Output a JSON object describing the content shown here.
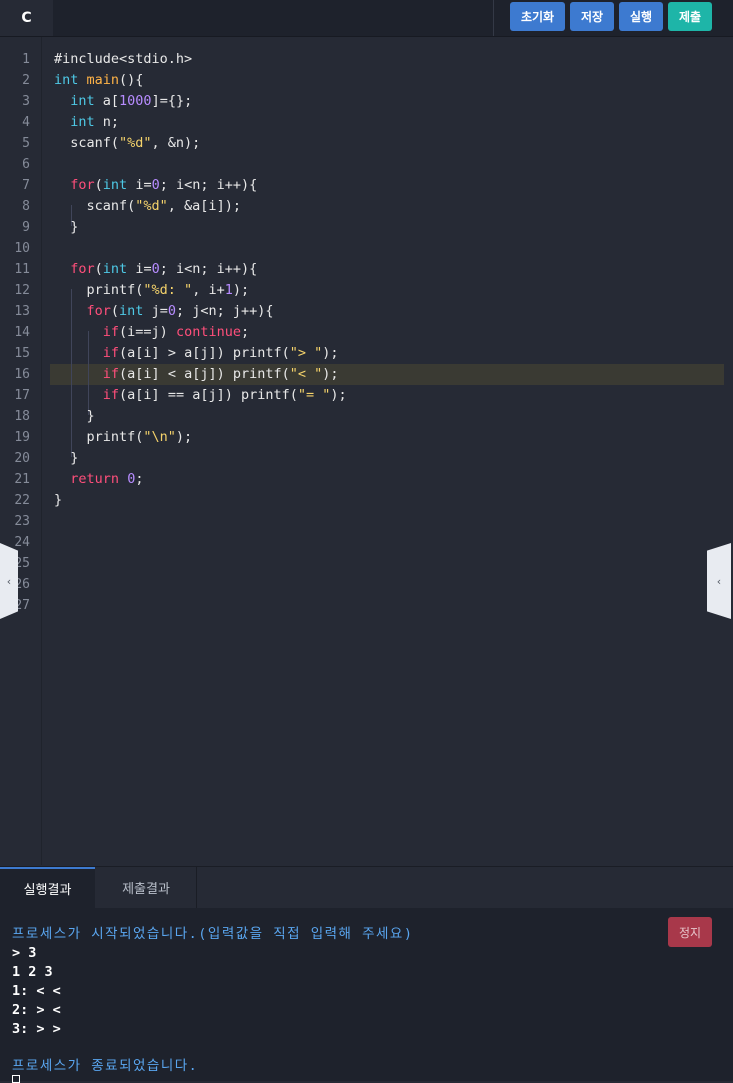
{
  "editor": {
    "language_tab": "C",
    "code_lines": [
      "#include<stdio.h>",
      "int main(){",
      "  int a[1000]={};",
      "  int n;",
      "  scanf(\"%d\", &n);",
      "",
      "  for(int i=0; i<n; i++){",
      "    scanf(\"%d\", &a[i]);",
      "  }",
      "",
      "  for(int i=0; i<n; i++){",
      "    printf(\"%d: \", i+1);",
      "    for(int j=0; j<n; j++){",
      "      if(i==j) continue;",
      "      if(a[i] > a[j]) printf(\"> \");",
      "      if(a[i] < a[j]) printf(\"< \");",
      "      if(a[i] == a[j]) printf(\"= \");",
      "    }",
      "    printf(\"\\n\");",
      "  }",
      "  return 0;",
      "}"
    ],
    "line_numbers": [
      "1",
      "2",
      "3",
      "4",
      "5",
      "6",
      "7",
      "8",
      "9",
      "10",
      "11",
      "12",
      "13",
      "14",
      "15",
      "16",
      "17",
      "18",
      "19",
      "20",
      "21",
      "22",
      "23",
      "24",
      "25",
      "26",
      "27"
    ],
    "highlighted_line": 16
  },
  "toolbar": {
    "reset_label": "초기화",
    "save_label": "저장",
    "run_label": "실행",
    "submit_label": "제출"
  },
  "side_tabs": {
    "left_glyph": "‹",
    "right_glyph": "‹"
  },
  "panel": {
    "tabs": [
      "실행결과",
      "제출결과"
    ],
    "active_tab": "실행결과",
    "stop_label": "정지"
  },
  "console": {
    "start_message": "프로세스가 시작되었습니다.(입력값을 직접 입력해 주세요)",
    "output_lines": [
      "> 3",
      "1 2 3",
      "1: < <",
      "2: > <",
      "3: > >"
    ],
    "end_message": "프로세스가 종료되었습니다."
  },
  "colors": {
    "keyword": "#ff4f7b",
    "type": "#4ec9e6",
    "function": "#ffb347",
    "number": "#b78cff",
    "string": "#f5d36b",
    "accent_blue": "#3d7ad0",
    "accent_teal": "#1eb5a8",
    "stop_red": "#a8384a"
  }
}
